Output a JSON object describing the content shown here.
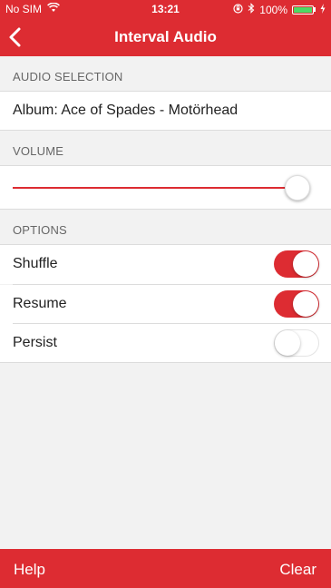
{
  "colors": {
    "accent": "#dd2c32",
    "background": "#f2f2f2",
    "battery": "#4cd964"
  },
  "status_bar": {
    "carrier": "No SIM",
    "time": "13:21",
    "battery_percent": "100%",
    "battery_level": 1.0,
    "icons": [
      "wifi-icon",
      "orientation-lock-icon",
      "bluetooth-icon",
      "battery-icon",
      "charging-icon"
    ]
  },
  "nav": {
    "title": "Interval Audio",
    "back_icon": "chevron-left-icon"
  },
  "sections": {
    "audio_selection": {
      "header": "AUDIO SELECTION",
      "value": "Album: Ace of Spades - Motörhead"
    },
    "volume": {
      "header": "VOLUME",
      "level": 1.0
    },
    "options": {
      "header": "OPTIONS",
      "items": [
        {
          "label": "Shuffle",
          "on": true
        },
        {
          "label": "Resume",
          "on": true
        },
        {
          "label": "Persist",
          "on": false
        }
      ]
    }
  },
  "footer": {
    "help_label": "Help",
    "clear_label": "Clear"
  }
}
